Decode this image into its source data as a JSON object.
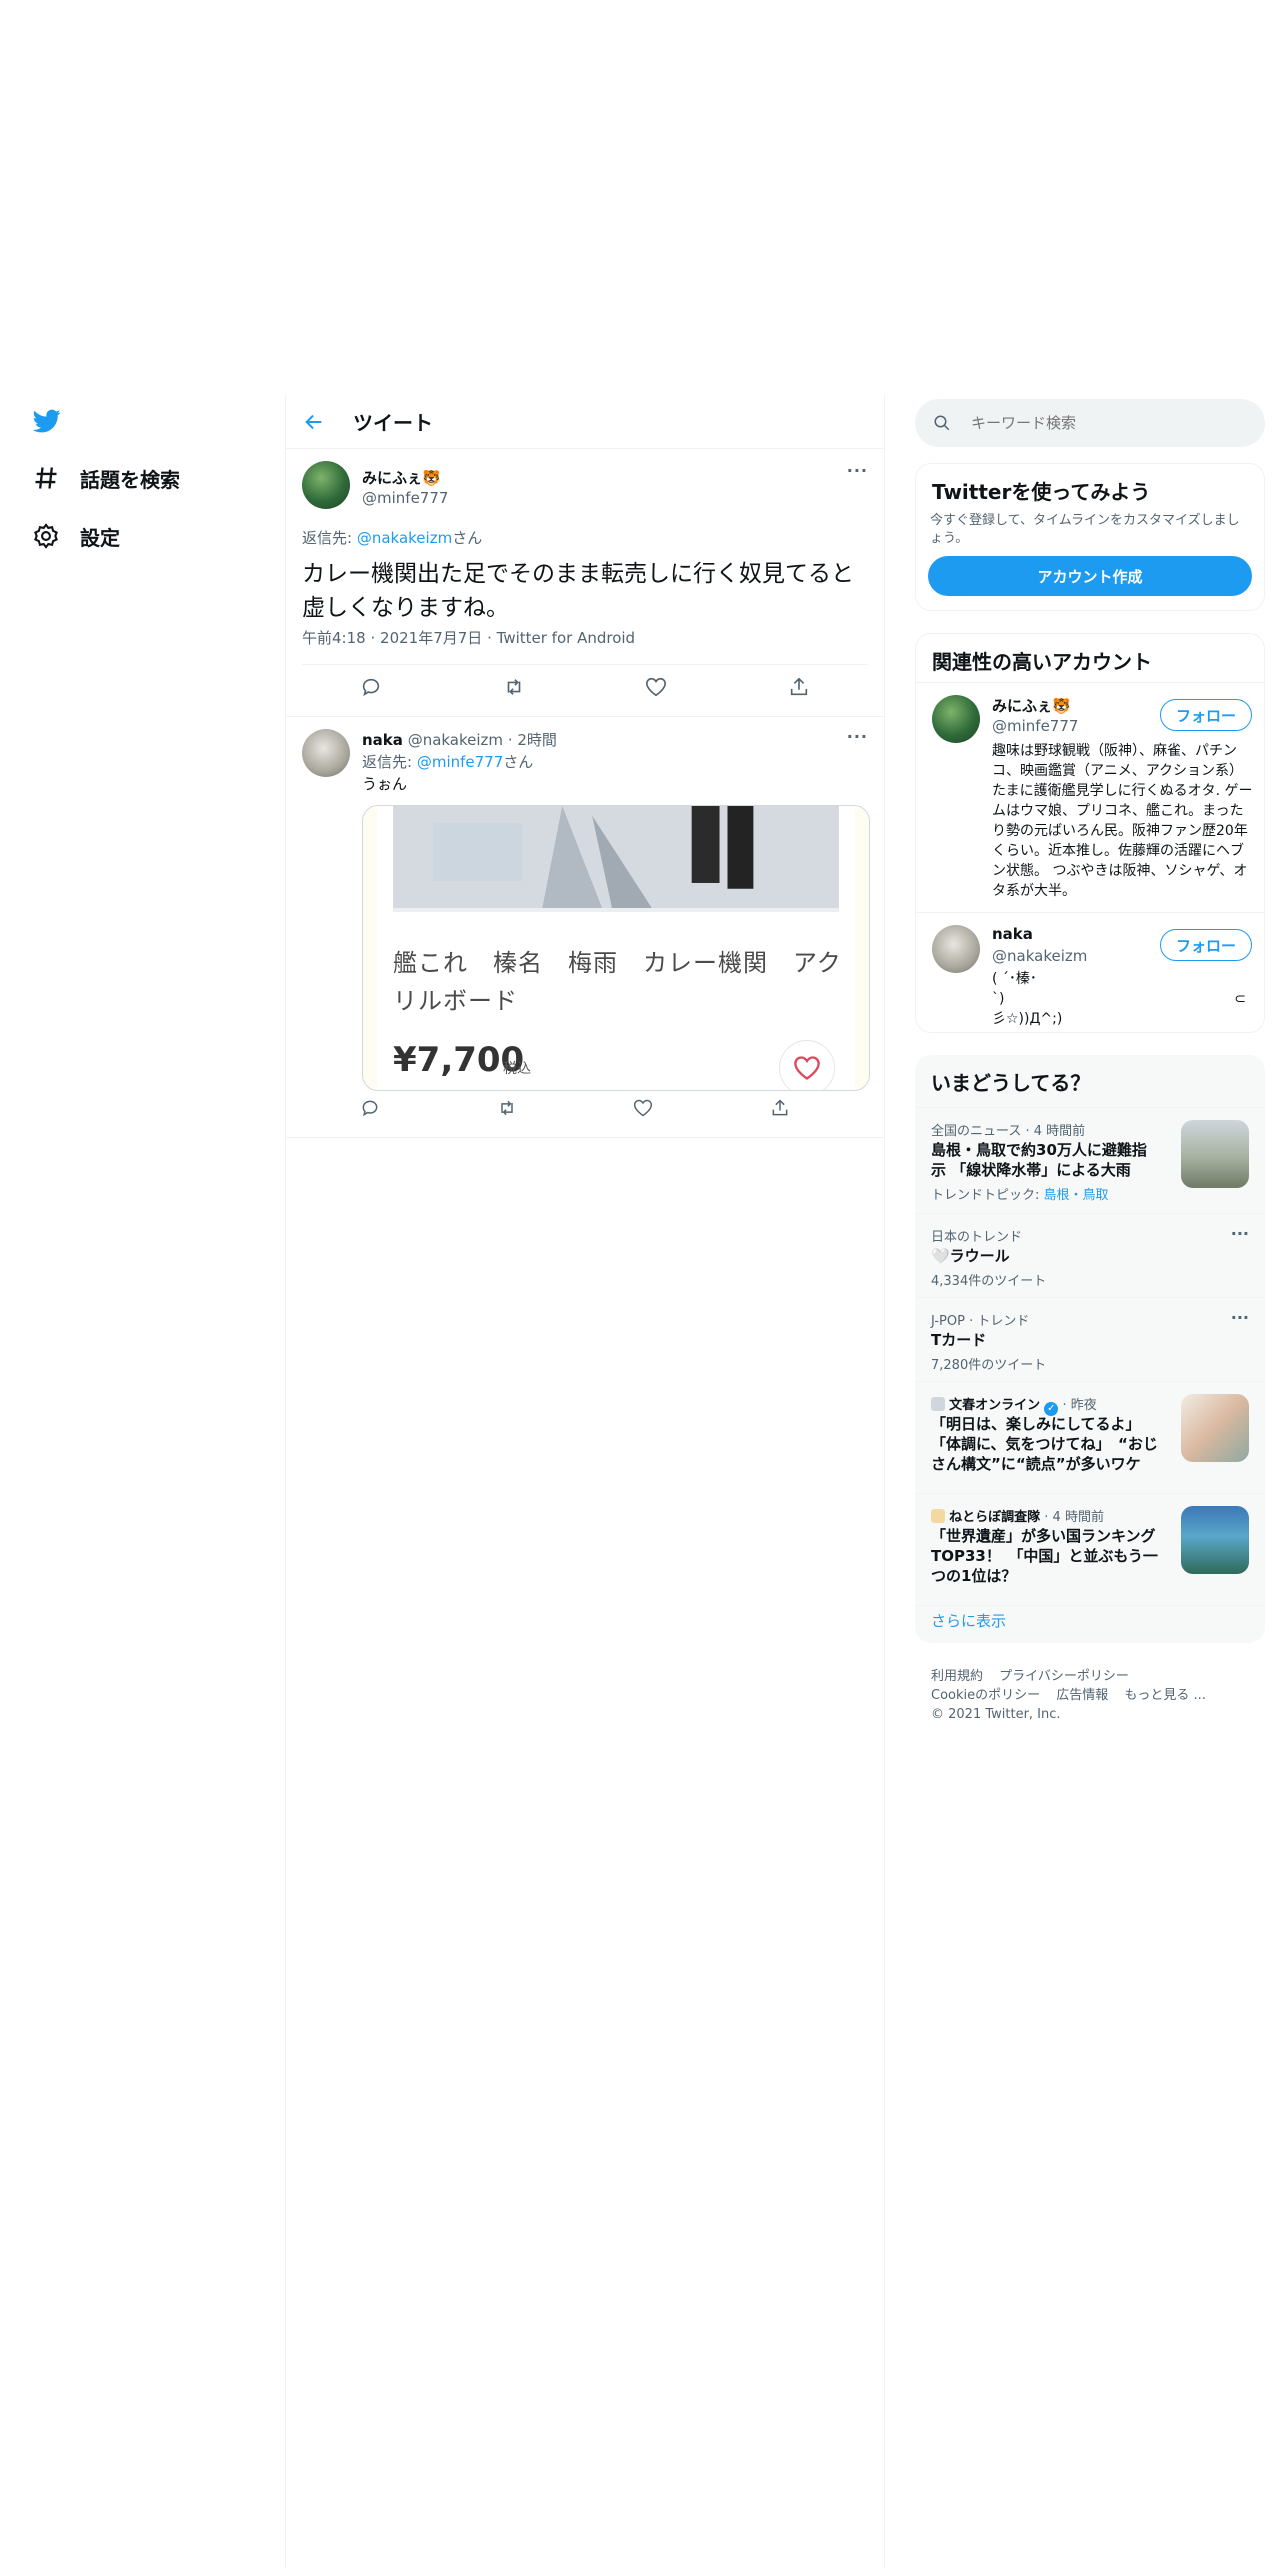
{
  "nav": {
    "items": [
      {
        "label": "話題を検索",
        "icon": "hashtag-icon"
      },
      {
        "label": "設定",
        "icon": "gear-icon"
      }
    ]
  },
  "header": {
    "title": "ツイート"
  },
  "focal_tweet": {
    "display_name": "みにふぇ🐯",
    "handle": "@minfe777",
    "reply_prefix": "返信先: ",
    "reply_handle": "@nakakeizm",
    "reply_suffix": "さん",
    "text": "カレー機関出た足でそのまま転売しに行く奴見てると虚しくなりますね。",
    "time": "午前4:18",
    "date": "2021年7月7日",
    "client": "Twitter for Android",
    "separator": "·"
  },
  "reply_tweet": {
    "display_name": "naka",
    "handle": "@nakakeizm",
    "time": "2時間",
    "separator": "·",
    "reply_prefix": "返信先: ",
    "reply_handle": "@minfe777",
    "reply_suffix": "さん",
    "text": "うぉん",
    "card": {
      "title": "艦これ　榛名　梅雨　カレー機関　アクリルボード",
      "price": "¥7,700",
      "tax": "税込"
    }
  },
  "search": {
    "placeholder": "キーワード検索"
  },
  "signup": {
    "title": "Twitterを使ってみよう",
    "desc": "今すぐ登録して、タイムラインをカスタマイズしましょう。",
    "button": "アカウント作成"
  },
  "related": {
    "title": "関連性の高いアカウント",
    "follow_label": "フォロー",
    "accounts": [
      {
        "name": "みにふぇ🐯",
        "handle": "@minfe777",
        "bio": "趣味は野球観戦（阪神）、麻雀、パチンコ、映画鑑賞（アニメ、アクション系） たまに護衛艦見学しに行くぬるオタ. ゲームはウマ娘、プリコネ、艦これ。まったり勢の元ばいろん民。阪神ファン歴20年くらい。近本推し。佐藤輝の活躍にヘブン状態。 つぶやきは阪神、ソシャゲ、オタ系が大半。"
      },
      {
        "name": "naka",
        "handle": "@nakakeizm",
        "bio_line1": "( ´･榛･",
        "bio_line2": "`)",
        "bio_line3": "彡☆))Д^;)",
        "bio_side": "⊂"
      }
    ]
  },
  "trends": {
    "title": "いまどうしてる？",
    "items": [
      {
        "meta": "全国のニュース · 4 時間前",
        "title": "島根・鳥取で約30万人に避難指示 「線状降水帯」による大雨",
        "sub_prefix": "トレンドトピック: ",
        "sub_link": "島根・鳥取"
      },
      {
        "meta": "日本のトレンド",
        "title": "🤍ラウール",
        "sub": "4,334件のツイート"
      },
      {
        "meta": "J-POP · トレンド",
        "title": "Tカード",
        "sub": "7,280件のツイート"
      },
      {
        "meta_name": "文春オンライン",
        "meta_time": "· 昨夜",
        "title": "「明日は、楽しみにしてるよ」「体調に、気をつけてね」　“おじさん構文”に“読点”が多いワケ"
      },
      {
        "meta_name": "ねとらぼ調査隊",
        "meta_time": "· 4 時間前",
        "title": "「世界遺産」が多い国ランキングTOP33！　「中国」と並ぶもう一つの1位は？"
      }
    ],
    "show_more": "さらに表示"
  },
  "footer": {
    "links": [
      "利用規約",
      "プライバシーポリシー",
      "Cookieのポリシー",
      "広告情報",
      "もっと見る ..."
    ],
    "copyright": "© 2021 Twitter, Inc."
  },
  "colors": {
    "accent": "#1d9bf0",
    "muted": "#536471",
    "border": "#eff3f4"
  }
}
